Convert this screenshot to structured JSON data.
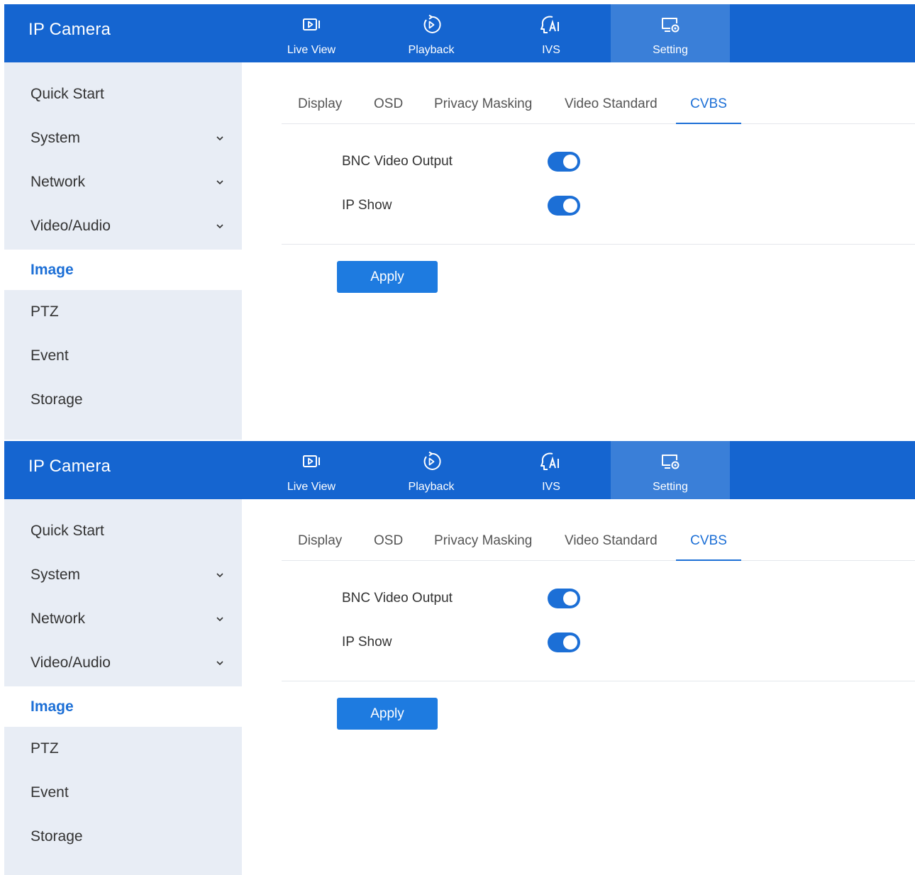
{
  "panels": [
    {
      "app_title": "IP Camera",
      "nav": [
        {
          "label": "Live View",
          "icon": "live-view-icon"
        },
        {
          "label": "Playback",
          "icon": "playback-icon"
        },
        {
          "label": "IVS",
          "icon": "ivs-ai-icon"
        },
        {
          "label": "Setting",
          "icon": "setting-icon",
          "active": true
        }
      ],
      "sidebar": [
        {
          "label": "Quick Start"
        },
        {
          "label": "System",
          "expandable": true
        },
        {
          "label": "Network",
          "expandable": true
        },
        {
          "label": "Video/Audio",
          "expandable": true
        },
        {
          "label": "Image",
          "active": true
        },
        {
          "label": "PTZ"
        },
        {
          "label": "Event"
        },
        {
          "label": "Storage"
        }
      ],
      "tabs": [
        {
          "label": "Display"
        },
        {
          "label": "OSD"
        },
        {
          "label": "Privacy Masking"
        },
        {
          "label": "Video Standard"
        },
        {
          "label": "CVBS",
          "active": true
        }
      ],
      "settings": [
        {
          "label": "BNC Video Output",
          "enabled": true
        },
        {
          "label": "IP Show",
          "enabled": true
        }
      ],
      "apply_label": "Apply"
    },
    {
      "app_title": "IP Camera",
      "nav": [
        {
          "label": "Live View",
          "icon": "live-view-icon"
        },
        {
          "label": "Playback",
          "icon": "playback-icon"
        },
        {
          "label": "IVS",
          "icon": "ivs-ai-icon"
        },
        {
          "label": "Setting",
          "icon": "setting-icon",
          "active": true
        }
      ],
      "sidebar": [
        {
          "label": "Quick Start"
        },
        {
          "label": "System",
          "expandable": true
        },
        {
          "label": "Network",
          "expandable": true
        },
        {
          "label": "Video/Audio",
          "expandable": true
        },
        {
          "label": "Image",
          "active": true
        },
        {
          "label": "PTZ"
        },
        {
          "label": "Event"
        },
        {
          "label": "Storage"
        }
      ],
      "tabs": [
        {
          "label": "Display"
        },
        {
          "label": "OSD"
        },
        {
          "label": "Privacy Masking"
        },
        {
          "label": "Video Standard"
        },
        {
          "label": "CVBS",
          "active": true
        }
      ],
      "settings": [
        {
          "label": "BNC Video Output",
          "enabled": true
        },
        {
          "label": "IP Show",
          "enabled": true
        }
      ],
      "apply_label": "Apply"
    }
  ],
  "colors": {
    "topbar": "#1565d0",
    "active_nav": "#3a7fd8",
    "sidebar_bg": "#e8edf5",
    "accent": "#1c6fd6",
    "button": "#1e7be0"
  }
}
